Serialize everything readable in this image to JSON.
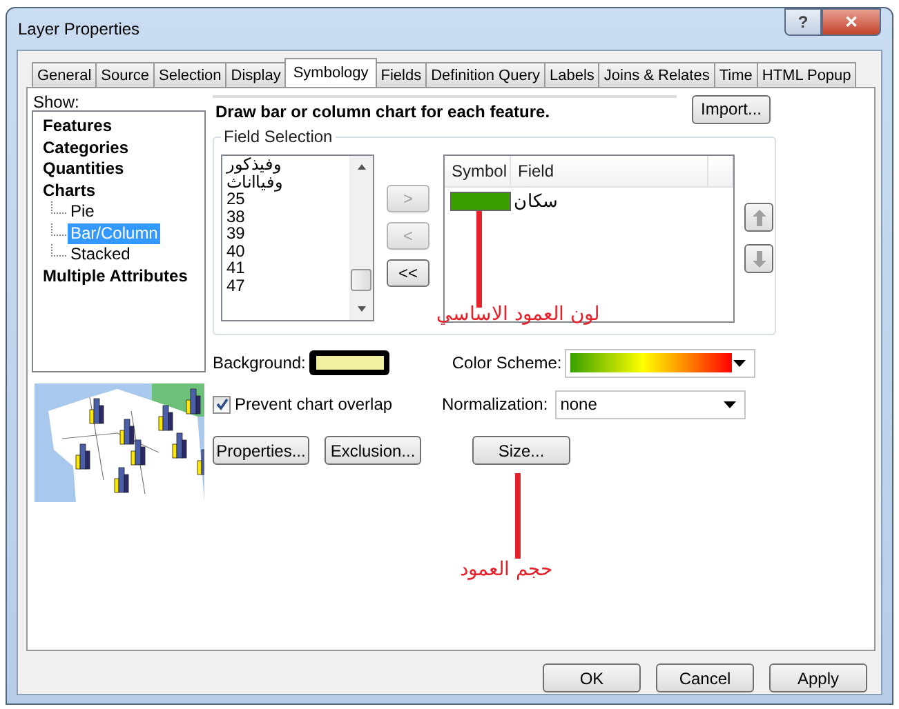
{
  "window": {
    "title": "Layer Properties",
    "title_buttons": [
      "?",
      "✕"
    ]
  },
  "tabs": [
    {
      "label": "General",
      "selected": false
    },
    {
      "label": "Source",
      "selected": false
    },
    {
      "label": "Selection",
      "selected": false
    },
    {
      "label": "Display",
      "selected": false
    },
    {
      "label": "Symbology",
      "selected": true
    },
    {
      "label": "Fields",
      "selected": false
    },
    {
      "label": "Definition Query",
      "selected": false
    },
    {
      "label": "Labels",
      "selected": false
    },
    {
      "label": "Joins & Relates",
      "selected": false
    },
    {
      "label": "Time",
      "selected": false
    },
    {
      "label": "HTML Popup",
      "selected": false
    }
  ],
  "show": {
    "label": "Show:",
    "tree": [
      {
        "label": "Features",
        "selected": false
      },
      {
        "label": "Categories",
        "selected": false
      },
      {
        "label": "Quantities",
        "selected": false
      },
      {
        "label": "Charts",
        "selected": false,
        "children": [
          {
            "label": "Pie",
            "selected": false
          },
          {
            "label": "Bar/Column",
            "selected": true
          },
          {
            "label": "Stacked",
            "selected": false
          }
        ]
      },
      {
        "label": "Multiple Attributes",
        "selected": false
      }
    ]
  },
  "description": "Draw bar or column chart for each feature.",
  "import_button": "Import...",
  "field_selection": {
    "title": "Field Selection",
    "available_fields": [
      "وفيذكور",
      "وفيااناث",
      "25",
      "38",
      "39",
      "40",
      "41",
      "47"
    ],
    "move_buttons": [
      {
        "label": ">",
        "disabled": true
      },
      {
        "label": "<",
        "disabled": true
      },
      {
        "label": "<<",
        "disabled": false
      }
    ],
    "table": {
      "columns": [
        "Symbol",
        "Field"
      ],
      "rows": [
        {
          "color": "#3a9f00",
          "field": "سكان"
        }
      ]
    }
  },
  "background": {
    "label": "Background:"
  },
  "color_scheme": {
    "label": "Color  Scheme:"
  },
  "prevent_overlap": {
    "label": "Prevent chart overlap",
    "checked": true
  },
  "normalization": {
    "label": "Normalization:",
    "value": "none"
  },
  "buttons": [
    "Properties...",
    "Exclusion...",
    "Size..."
  ],
  "annotations": [
    {
      "text": "لون العمود الاساسي"
    },
    {
      "text": "حجم العمود"
    }
  ],
  "dialog_buttons": [
    "OK",
    "Cancel",
    "Apply"
  ]
}
